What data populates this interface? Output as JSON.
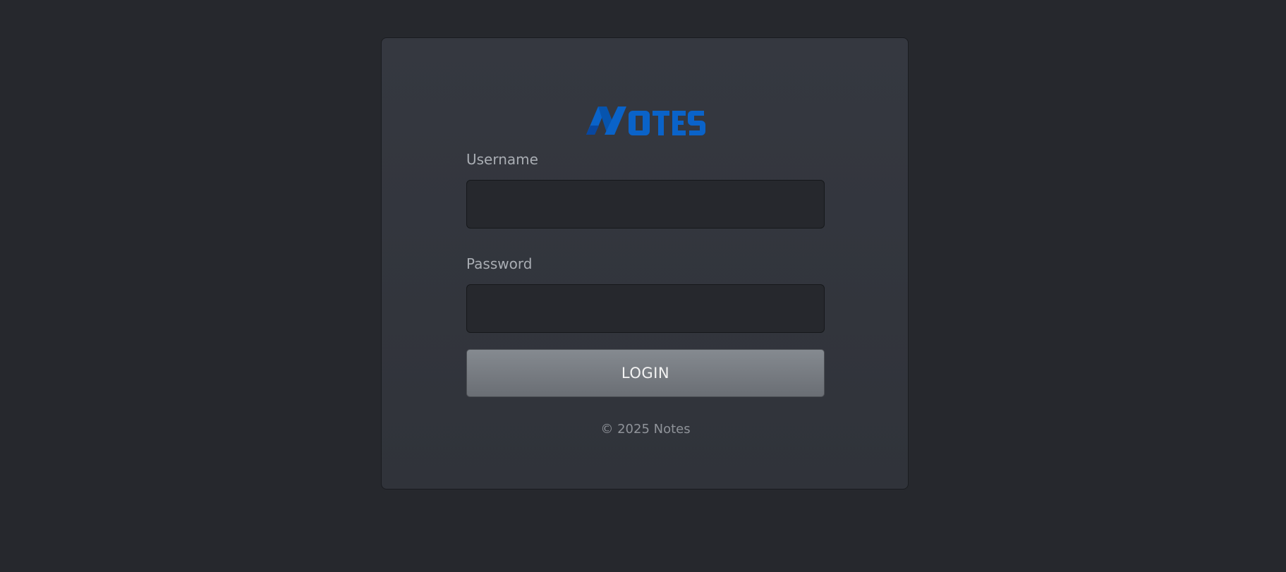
{
  "brand": {
    "logo_text": "NOTES",
    "color": "#0a63c9"
  },
  "form": {
    "username": {
      "label": "Username",
      "value": "",
      "placeholder": ""
    },
    "password": {
      "label": "Password",
      "value": "",
      "placeholder": ""
    },
    "login_label": "LOGIN"
  },
  "footer": {
    "text": "© 2025 Notes"
  },
  "colors": {
    "background": "#26282d",
    "card": "#353840",
    "accent": "#0a63c9"
  },
  "icons": {
    "logo": "notes-logo-icon"
  }
}
